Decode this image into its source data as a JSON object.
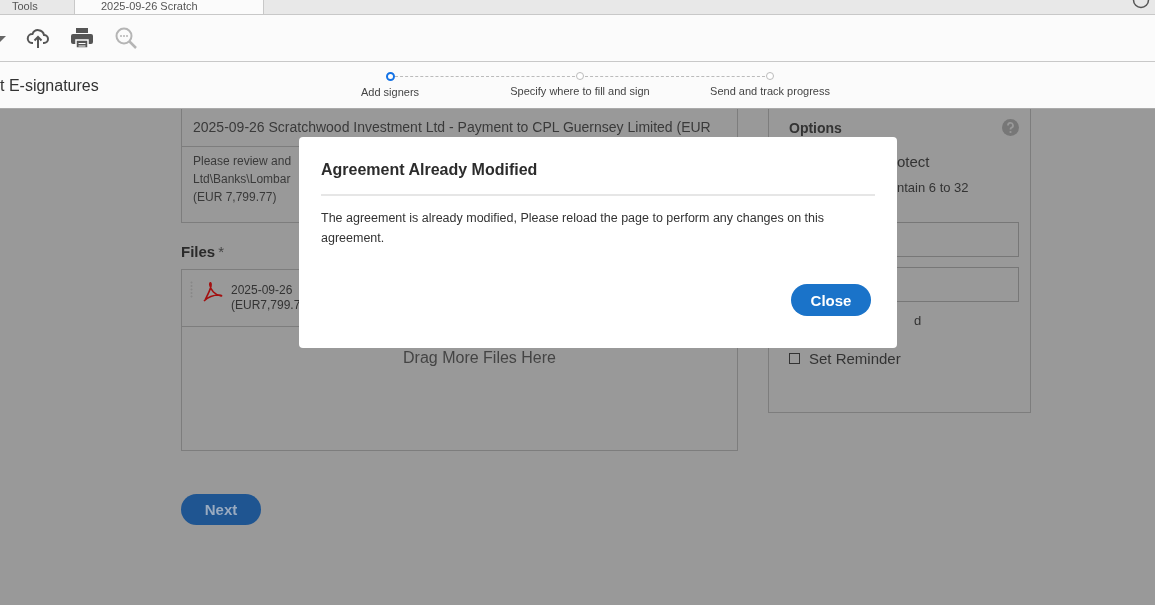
{
  "tabs": [
    {
      "label": "Tools",
      "selected": false
    },
    {
      "label": "2025-09-26 Scratch",
      "selected": true
    }
  ],
  "page_title": "t E-signatures",
  "steps": [
    {
      "label": "Add signers",
      "selected": true
    },
    {
      "label": "Specify where to fill and sign",
      "selected": false
    },
    {
      "label": "Send and track progress",
      "selected": false
    }
  ],
  "document": {
    "title": "2025-09-26 Scratchwood Investment Ltd - Payment to CPL Guernsey Limited (EUR",
    "message_lines": [
      "Please review and",
      "Ltd\\Banks\\Lombar",
      "(EUR 7,799.77)"
    ]
  },
  "files": {
    "label": "Files",
    "required_mark": "*",
    "items": [
      {
        "lines": [
          "2025-09-26",
          "(EUR7,799.7"
        ]
      }
    ],
    "drop_hint": "Drag More Files Here"
  },
  "next_button": "Next",
  "options": {
    "title": "Options",
    "texts": [
      "otect",
      "ntain 6 to 32"
    ],
    "fragment": "d",
    "reminder": {
      "label": "Set Reminder",
      "checked": false
    }
  },
  "dialog": {
    "title": "Agreement Already Modified",
    "message": "The agreement is already modified, Please reload the page to perform any changes on this agreement.",
    "button": "Close"
  }
}
